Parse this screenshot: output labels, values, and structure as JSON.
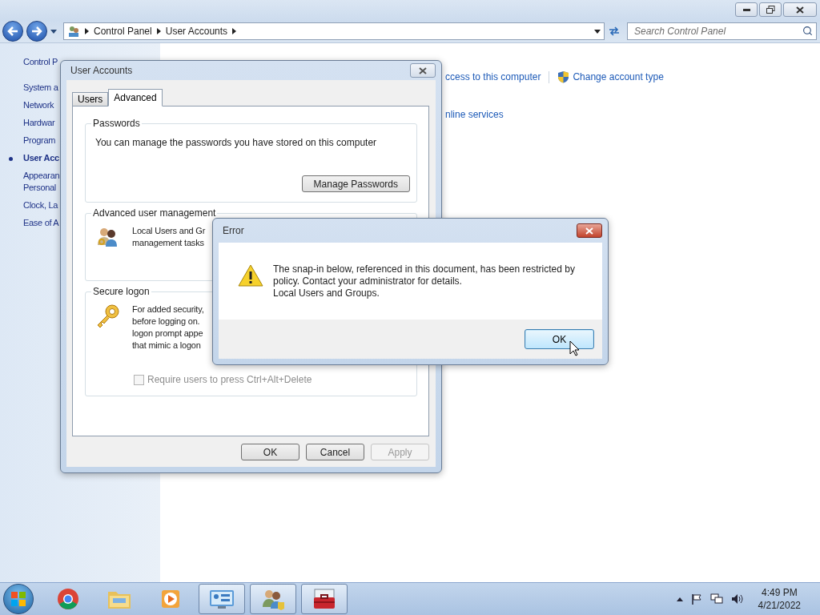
{
  "address_bar": {
    "breadcrumbs": [
      "Control Panel",
      "User Accounts"
    ]
  },
  "search": {
    "placeholder": "Search Control Panel"
  },
  "sidebar": {
    "items": [
      {
        "lines": [
          "Control P"
        ],
        "selected": false
      },
      {
        "lines": [
          "System a"
        ],
        "selected": false
      },
      {
        "lines": [
          "Network"
        ],
        "selected": false
      },
      {
        "lines": [
          "Hardwar"
        ],
        "selected": false
      },
      {
        "lines": [
          "Program"
        ],
        "selected": false
      },
      {
        "lines": [
          "User Acc"
        ],
        "selected": true
      },
      {
        "lines": [
          "Appearan",
          "Personal"
        ],
        "selected": false
      },
      {
        "lines": [
          "Clock, La"
        ],
        "selected": false
      },
      {
        "lines": [
          "Ease of A"
        ],
        "selected": false
      }
    ]
  },
  "content": {
    "rows": [
      [
        {
          "label": "ccess to this computer",
          "kind": "plain"
        },
        {
          "label": "Change account type",
          "kind": "shield"
        }
      ],
      [
        {
          "label": "nline services",
          "kind": "plain"
        }
      ]
    ]
  },
  "dialog": {
    "title": "User Accounts",
    "tabs": [
      {
        "label": "Users",
        "selected": false
      },
      {
        "label": "Advanced",
        "selected": true
      }
    ],
    "passwords": {
      "title": "Passwords",
      "text": "You can manage the passwords you have stored on this computer",
      "button": "Manage Passwords"
    },
    "advanced": {
      "title": "Advanced user management",
      "lines": [
        "Local Users and Gr",
        "management tasks"
      ]
    },
    "secure": {
      "title": "Secure logon",
      "lines": [
        "For added security,",
        "before logging on.",
        "logon prompt appe",
        "that mimic a logon"
      ],
      "checkbox": {
        "label": "Require users to press Ctrl+Alt+Delete",
        "checked": false,
        "disabled": true
      }
    },
    "buttons": [
      {
        "label": "OK",
        "disabled": false
      },
      {
        "label": "Cancel",
        "disabled": false
      },
      {
        "label": "Apply",
        "disabled": true
      }
    ]
  },
  "error": {
    "title": "Error",
    "message": "The snap-in below, referenced in this document, has been restricted by policy. Contact your administrator for details.",
    "detail": "Local Users and Groups.",
    "button": "OK"
  },
  "taskbar": {
    "items": [
      {
        "kind": "chrome",
        "running": false
      },
      {
        "kind": "folder",
        "running": false
      },
      {
        "kind": "media",
        "running": false
      },
      {
        "kind": "control",
        "running": true
      },
      {
        "kind": "users",
        "running": true
      },
      {
        "kind": "toolbox",
        "running": true
      }
    ],
    "clock": {
      "time": "4:49 PM",
      "date": "4/21/2022"
    }
  }
}
